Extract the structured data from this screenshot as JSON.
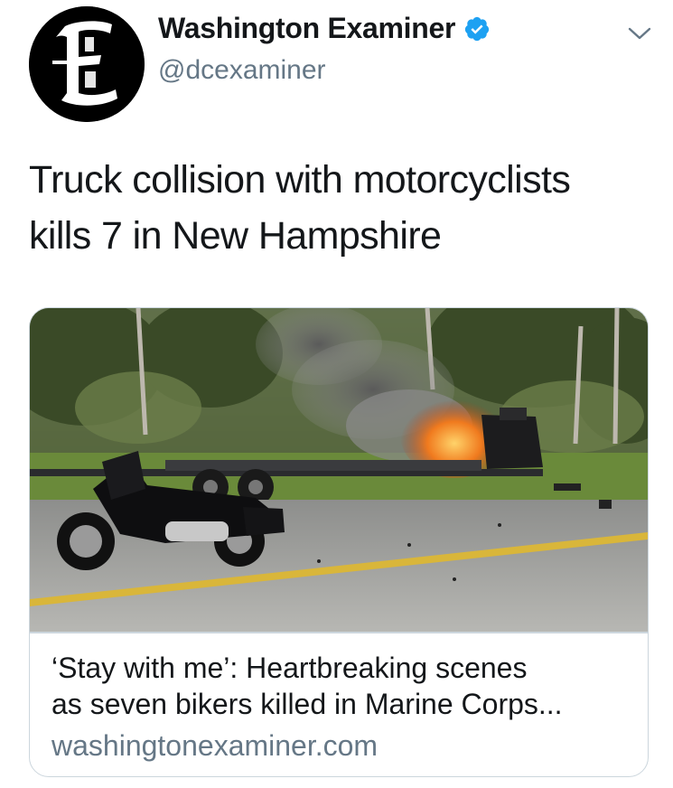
{
  "author": {
    "display_name": "Washington Examiner",
    "handle": "@dcexaminer",
    "verified": true,
    "avatar_letter": "E",
    "avatar_icon": "washington-examiner-logo",
    "menu_icon": "chevron-down-icon"
  },
  "tweet": {
    "text_line_1": "Truck collision with motorcyclists",
    "text_line_2": "kills 7 in New Hampshire"
  },
  "card": {
    "image_description_icon": "crash-scene-photo",
    "title_line_1": "‘Stay with me’: Heartbreaking scenes",
    "title_line_2": "as seven bikers killed in Marine Corps...",
    "domain": "washingtonexaminer.com"
  },
  "colors": {
    "verified_blue": "#1da1f2",
    "text_primary": "#14171a",
    "text_secondary": "#657786",
    "border": "#ccd6dd"
  }
}
